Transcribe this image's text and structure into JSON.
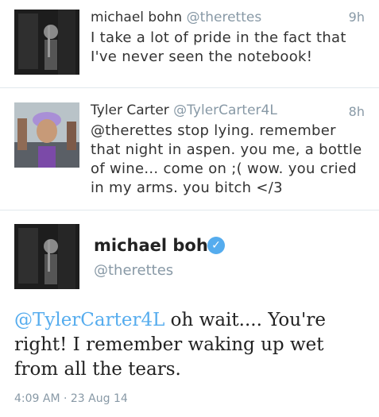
{
  "tweets": [
    {
      "name": "michael bohn",
      "handle": "@therettes",
      "time": "9h",
      "text_lines": [
        "I take a lot of pride in the fact that",
        "I've never seen the notebook!"
      ]
    },
    {
      "name": "Tyler Carter",
      "handle": "@TylerCarter4L",
      "time": "8h",
      "text_lines": [
        "@therettes stop lying. remember",
        "that night in aspen. you me, a bottle",
        "of wine... come on ;( wow. you cried",
        "in my arms. you bitch </3"
      ]
    }
  ],
  "focused": {
    "name": "michael bohn",
    "handle": "@therettes",
    "mention": "@TylerCarter4L",
    "text_rest": " oh wait.... You're right! I remember waking up wet from all the tears.",
    "timestamp": "4:09 AM · 23 Aug 14",
    "verified_icon": "verified-check-icon"
  },
  "colors": {
    "accent": "#55acee",
    "muted": "#8899a6"
  }
}
